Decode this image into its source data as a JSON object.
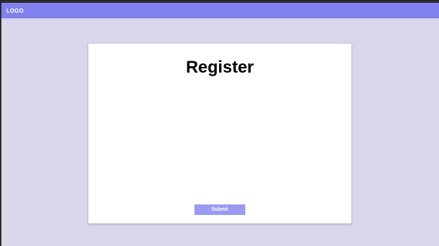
{
  "header": {
    "logo_text": "LOGO",
    "background_color": "#8281f0"
  },
  "page": {
    "background_color": "#d8d6ea"
  },
  "form": {
    "title": "Register",
    "submit_label": "Submit",
    "submit_color": "#9b9af0"
  }
}
